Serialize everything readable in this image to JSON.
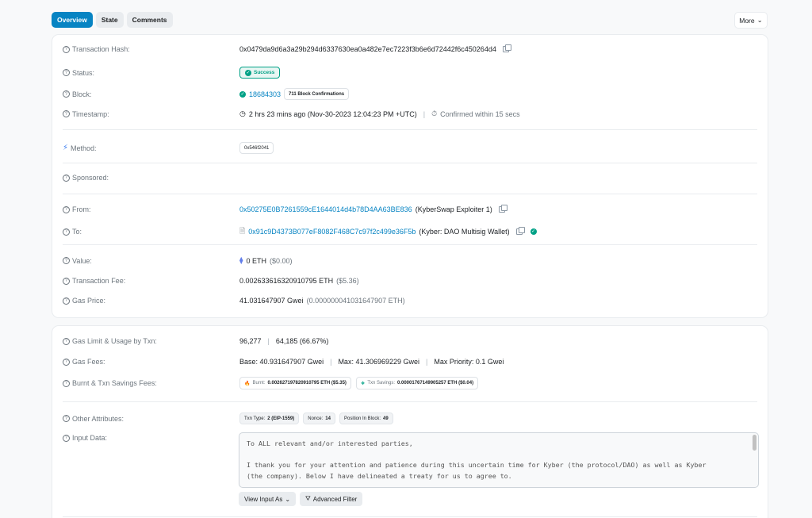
{
  "tabs": [
    "Overview",
    "State",
    "Comments"
  ],
  "more_label": "More",
  "card1": {
    "tx_hash": {
      "label": "Transaction Hash:",
      "value": "0x0479da9d6a3a29b294d6337630ea0a482e7ec7223f3b6e6d72442f6c450264d4"
    },
    "status": {
      "label": "Status:",
      "value": "Success"
    },
    "block": {
      "label": "Block:",
      "value": "18684303",
      "confirmations": "711 Block Confirmations"
    },
    "timestamp": {
      "label": "Timestamp:",
      "value": "2 hrs 23 mins ago (Nov-30-2023 12:04:23 PM +UTC)",
      "confirmed": "Confirmed within 15 secs"
    },
    "method": {
      "label": "Method:",
      "value": "0x546f2041"
    },
    "sponsored": {
      "label": "Sponsored:"
    },
    "from": {
      "label": "From:",
      "address": "0x50275E0B7261559cE1644014d4b78D4AA63BE836",
      "name": "(KyberSwap Exploiter 1)"
    },
    "to": {
      "label": "To:",
      "address": "0x91c9D4373B077eF8082F468C7c97f2c499e36F5b",
      "name": "(Kyber: DAO Multisig Wallet)"
    },
    "value": {
      "label": "Value:",
      "amount": "0 ETH",
      "usd": "($0.00)"
    },
    "fee": {
      "label": "Transaction Fee:",
      "amount": "0.002633616320910795 ETH",
      "usd": "($5.36)"
    },
    "gas_price": {
      "label": "Gas Price:",
      "gwei": "41.031647907 Gwei",
      "eth": "(0.000000041031647907 ETH)"
    }
  },
  "card2": {
    "gas_limit": {
      "label": "Gas Limit & Usage by Txn:",
      "limit": "96,277",
      "usage": "64,185 (66.67%)"
    },
    "gas_fees": {
      "label": "Gas Fees:",
      "base": "Base: 40.931647907 Gwei",
      "max": "Max: 41.306969229 Gwei",
      "priority": "Max Priority: 0.1 Gwei"
    },
    "burnt": {
      "label": "Burnt & Txn Savings Fees:",
      "burnt_label": "Burnt:",
      "burnt_value": "0.002627197820910795 ETH ($5.35)",
      "savings_label": "Txn Savings:",
      "savings_value": "0.00001767149905257 ETH ($0.04)"
    },
    "other": {
      "label": "Other Attributes:",
      "txn_type_label": "Txn Type:",
      "txn_type": "2 (EIP-1559)",
      "nonce_label": "Nonce:",
      "nonce": "14",
      "position_label": "Position In Block:",
      "position": "49"
    },
    "input": {
      "label": "Input Data:",
      "line1": "To ALL relevant and/or interested parties,",
      "line2": "I thank you for your attention and patience during this uncertain time for Kyber (the protocol/DAO) as well as Kyber",
      "line3": "(the company). Below I have delineated a treaty for us to agree to.",
      "view_as": "View Input As",
      "advanced": "Advanced Filter"
    }
  },
  "colors": {
    "accent": "#0784c3",
    "success": "#00a186"
  }
}
